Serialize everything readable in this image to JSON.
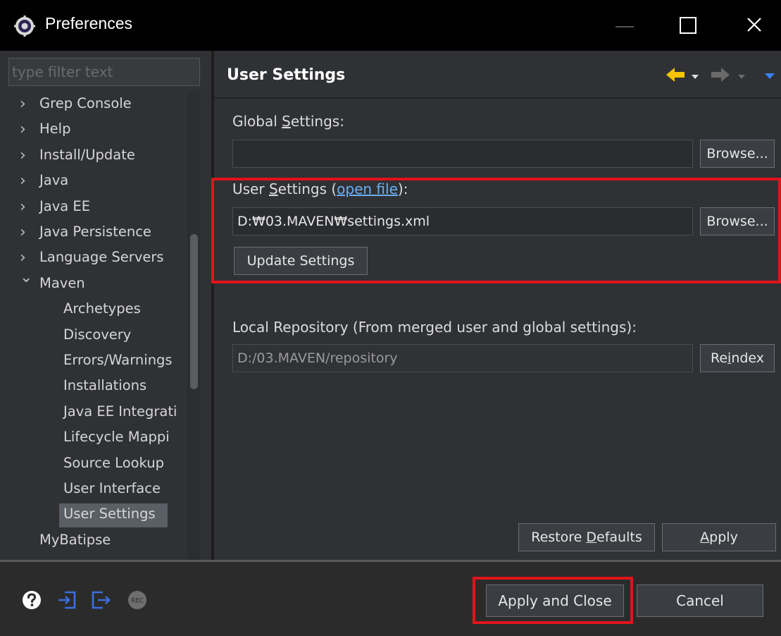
{
  "window": {
    "title": "Preferences"
  },
  "filter": {
    "placeholder": "type filter text"
  },
  "tree": [
    {
      "label": "Grep Console",
      "expanded": false,
      "child": false
    },
    {
      "label": "Help",
      "expanded": false,
      "child": false
    },
    {
      "label": "Install/Update",
      "expanded": false,
      "child": false
    },
    {
      "label": "Java",
      "expanded": false,
      "child": false
    },
    {
      "label": "Java EE",
      "expanded": false,
      "child": false
    },
    {
      "label": "Java Persistence",
      "expanded": false,
      "child": false
    },
    {
      "label": "Language Servers",
      "expanded": false,
      "child": false
    },
    {
      "label": "Maven",
      "expanded": true,
      "child": false
    },
    {
      "label": "Archetypes",
      "child": true
    },
    {
      "label": "Discovery",
      "child": true
    },
    {
      "label": "Errors/Warnings",
      "child": true
    },
    {
      "label": "Installations",
      "child": true
    },
    {
      "label": "Java EE Integrati",
      "child": true
    },
    {
      "label": "Lifecycle Mappi",
      "child": true
    },
    {
      "label": "Source Lookup",
      "child": true
    },
    {
      "label": "User Interface",
      "child": true
    },
    {
      "label": "User Settings",
      "child": true,
      "selected": true
    },
    {
      "label": "MyBatipse",
      "child": false,
      "leaf": true
    }
  ],
  "page": {
    "title": "User Settings",
    "global_settings": {
      "label_pre": "Global ",
      "label_mnemonic": "S",
      "label_post": "ettings:",
      "value": "",
      "browse": "Browse..."
    },
    "user_settings": {
      "label_pre": "User ",
      "label_mnemonic": "S",
      "label_mid": "ettings (",
      "link": "open file",
      "label_post": "):",
      "value": "D:₩03.MAVEN₩settings.xml",
      "browse": "Browse...",
      "update": "Update Settings"
    },
    "local_repo": {
      "label": "Local Repository (From merged user and global settings):",
      "value": "D:/03.MAVEN/repository",
      "reindex_pre": "Re",
      "reindex_mnemonic": "i",
      "reindex_post": "ndex"
    },
    "restore_pre": "Restore ",
    "restore_mnemonic": "D",
    "restore_post": "efaults",
    "apply_mnemonic": "A",
    "apply_post": "pply"
  },
  "footer": {
    "apply_close": "Apply and Close",
    "cancel": "Cancel",
    "rec_badge": "REC"
  },
  "colors": {
    "highlight": "#e0141b",
    "link": "#6ab0f3",
    "nav_arrow": "#f5c400",
    "footer_icon": "#3b6fe0"
  }
}
